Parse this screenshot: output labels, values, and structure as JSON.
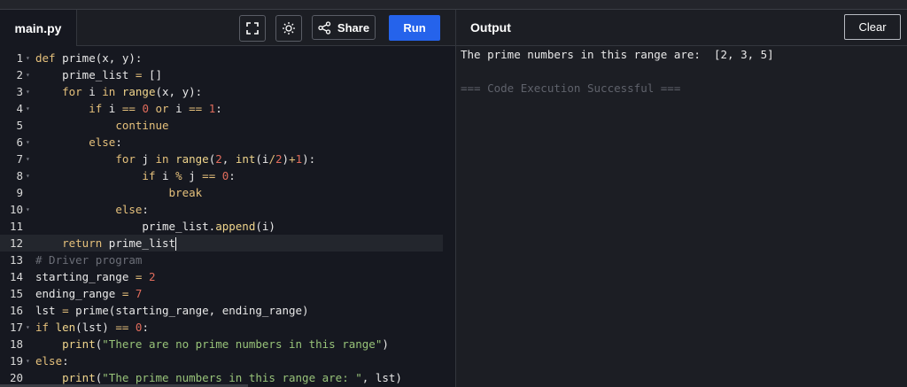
{
  "header": {
    "file_tab": "main.py",
    "share_label": "Share",
    "run_label": "Run",
    "output_title": "Output",
    "clear_label": "Clear",
    "icons": [
      "fullscreen-icon",
      "theme-sun-icon",
      "share-icon"
    ]
  },
  "editor": {
    "active_line": 12,
    "lines": [
      {
        "n": "1",
        "text": "def prime(x, y):"
      },
      {
        "n": "2",
        "text": "    prime_list = []"
      },
      {
        "n": "3",
        "text": "    for i in range(x, y):"
      },
      {
        "n": "4",
        "text": "        if i == 0 or i == 1:"
      },
      {
        "n": "5",
        "text": "            continue"
      },
      {
        "n": "6",
        "text": "        else:"
      },
      {
        "n": "7",
        "text": "            for j in range(2, int(i/2)+1):"
      },
      {
        "n": "8",
        "text": "                if i % j == 0:"
      },
      {
        "n": "9",
        "text": "                    break"
      },
      {
        "n": "10",
        "text": "            else:"
      },
      {
        "n": "11",
        "text": "                prime_list.append(i)"
      },
      {
        "n": "12",
        "text": "    return prime_list"
      },
      {
        "n": "13",
        "text": "# Driver program"
      },
      {
        "n": "14",
        "text": "starting_range = 2"
      },
      {
        "n": "15",
        "text": "ending_range = 7"
      },
      {
        "n": "16",
        "text": "lst = prime(starting_range, ending_range)"
      },
      {
        "n": "17",
        "text": "if len(lst) == 0:"
      },
      {
        "n": "18",
        "text": "    print(\"There are no prime numbers in this range\")"
      },
      {
        "n": "19",
        "text": "else:"
      },
      {
        "n": "20",
        "text": "    print(\"The prime numbers in this range are: \", lst)"
      }
    ]
  },
  "output": {
    "result": "The prime numbers in this range are:  [2, 3, 5]",
    "status": "=== Code Execution Successful ==="
  },
  "colors": {
    "run_button": "#2563eb",
    "background": "#1c1e24",
    "editor_background": "#161820"
  }
}
